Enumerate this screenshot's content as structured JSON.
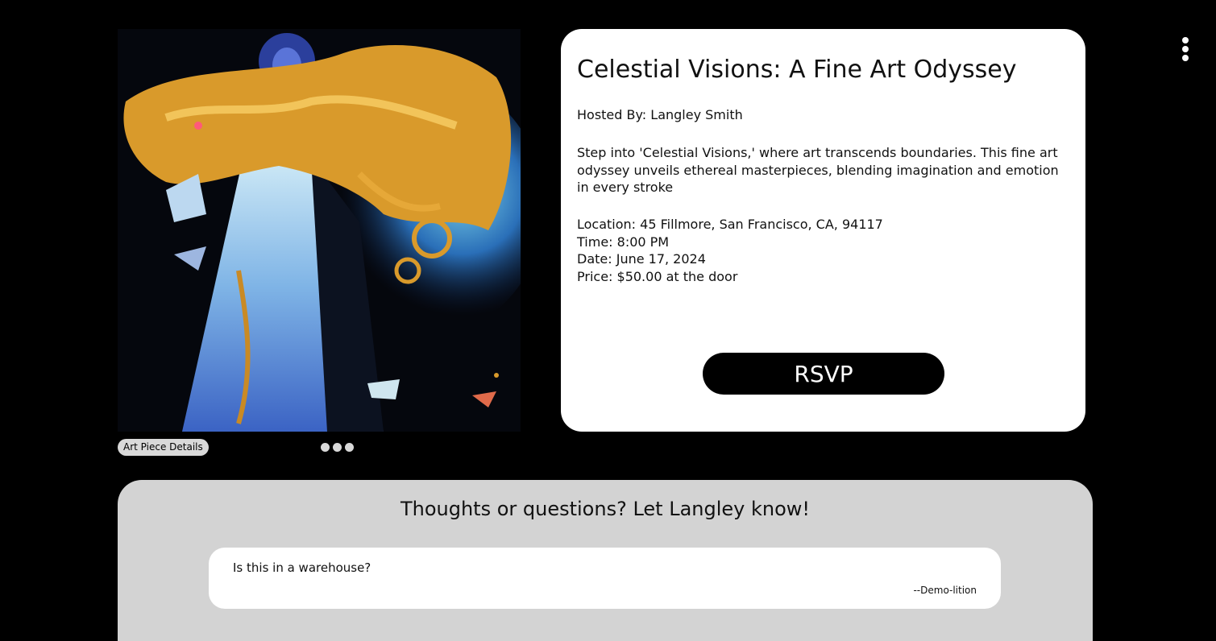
{
  "menu": {
    "icon": "kebab-menu-icon"
  },
  "artwork": {
    "badge_label": "Art Piece Details",
    "carousel_dots": 3
  },
  "event": {
    "title": "Celestial Visions: A Fine Art Odyssey",
    "host": "Hosted By: Langley Smith",
    "description": "Step into 'Celestial Visions,' where art transcends boundaries. This fine art odyssey unveils ethereal masterpieces, blending imagination and emotion in every stroke",
    "location": "Location: 45 Fillmore, San Francisco, CA, 94117",
    "time": "Time: 8:00 PM",
    "date": "Date: June 17, 2024",
    "price": "Price: $50.00 at the door",
    "rsvp_label": "RSVP"
  },
  "comments": {
    "heading": "Thoughts or questions? Let Langley know!",
    "items": [
      {
        "text": "Is this in a warehouse?",
        "author": "--Demo-lition"
      }
    ]
  }
}
